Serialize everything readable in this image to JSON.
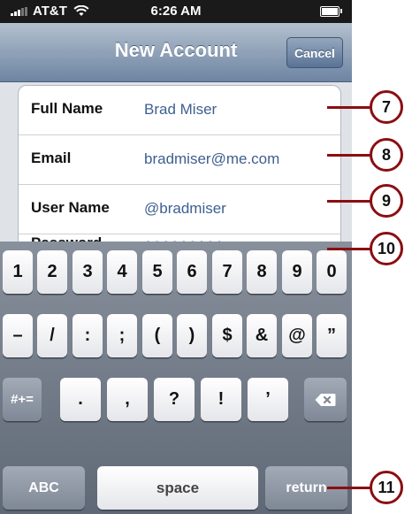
{
  "status_bar": {
    "carrier": "AT&T",
    "time": "6:26 AM"
  },
  "nav": {
    "title": "New Account",
    "cancel_label": "Cancel"
  },
  "form": {
    "rows": [
      {
        "label": "Full Name",
        "value": "Brad Miser"
      },
      {
        "label": "Email",
        "value": "bradmiser@me.com"
      },
      {
        "label": "User Name",
        "value": "@bradmiser"
      },
      {
        "label": "Password",
        "value": "●●●●●●●●●"
      }
    ]
  },
  "keyboard": {
    "row1": [
      "1",
      "2",
      "3",
      "4",
      "5",
      "6",
      "7",
      "8",
      "9",
      "0"
    ],
    "row2": [
      "–",
      "/",
      ":",
      ";",
      "(",
      ")",
      "$",
      "&",
      "@",
      "”"
    ],
    "row3": [
      ".",
      ",",
      "?",
      "!",
      "’"
    ],
    "shift_label": "#+=",
    "abc_label": "ABC",
    "space_label": "space",
    "return_label": "return"
  },
  "callouts": [
    "7",
    "8",
    "9",
    "10",
    "11"
  ],
  "colors": {
    "callout": "#8b0d12",
    "value_text": "#3d5f8f",
    "nav_top": "#b3c0ce",
    "nav_bottom": "#6d84a2"
  }
}
